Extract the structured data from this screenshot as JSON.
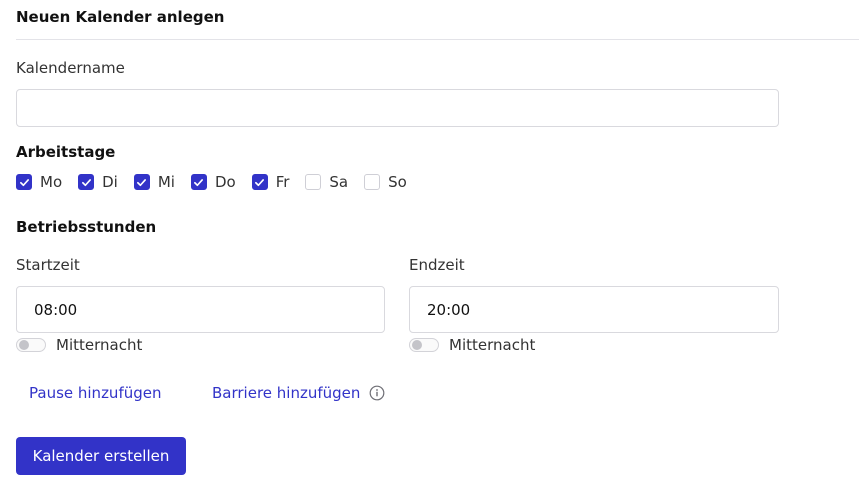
{
  "form": {
    "title": "Neuen Kalender anlegen",
    "name_label": "Kalendername",
    "name_value": "",
    "name_placeholder": "",
    "workdays_label": "Arbeitstage",
    "days": [
      {
        "label": "Mo",
        "checked": true
      },
      {
        "label": "Di",
        "checked": true
      },
      {
        "label": "Mi",
        "checked": true
      },
      {
        "label": "Do",
        "checked": true
      },
      {
        "label": "Fr",
        "checked": true
      },
      {
        "label": "Sa",
        "checked": false
      },
      {
        "label": "So",
        "checked": false
      }
    ],
    "hours_label": "Betriebsstunden",
    "start": {
      "label": "Startzeit",
      "value": "08:00",
      "toggle_label": "Mitternacht",
      "toggle_on": false
    },
    "end": {
      "label": "Endzeit",
      "value": "20:00",
      "toggle_label": "Mitternacht",
      "toggle_on": false
    },
    "add_pause": "Pause hinzufügen",
    "add_barrier": "Barriere hinzufügen",
    "submit": "Kalender erstellen"
  },
  "colors": {
    "accent": "#3233c8",
    "border": "#d9d9de"
  },
  "icons": {
    "checkbox_check": "check-icon",
    "barrier_info": "info-icon"
  }
}
